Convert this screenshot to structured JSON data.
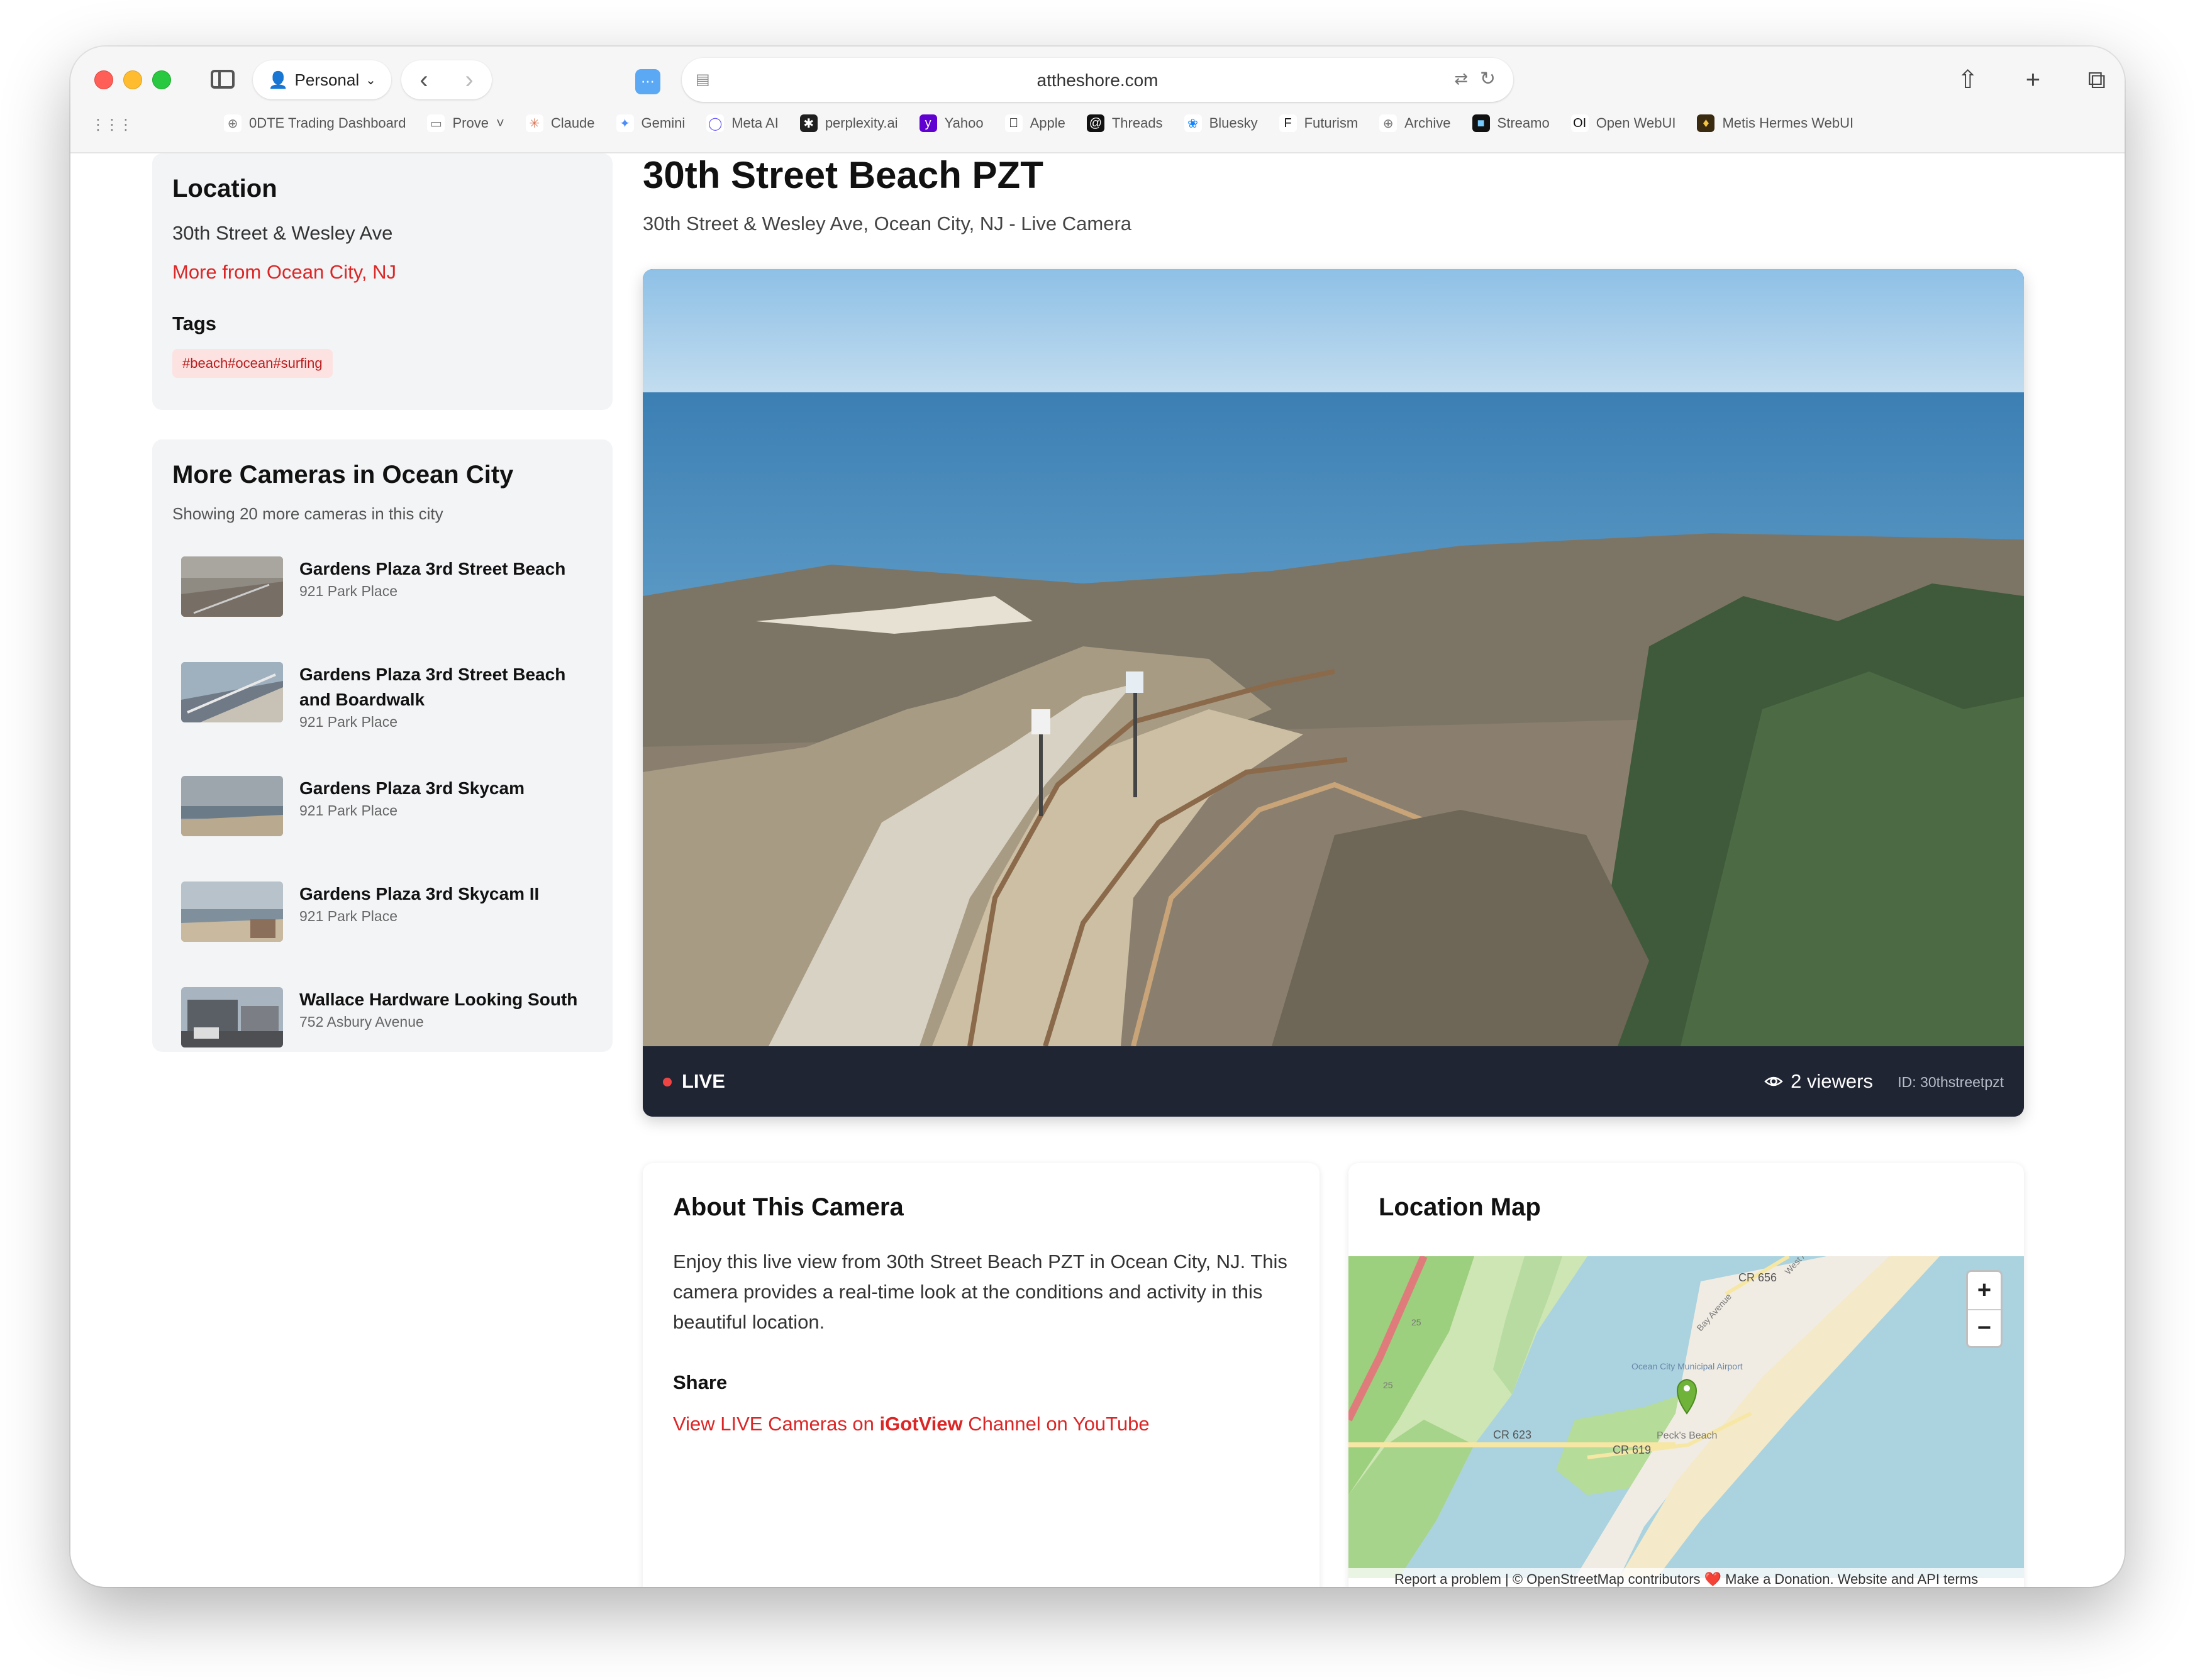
{
  "browser": {
    "profile_label": "Personal",
    "url": "attheshore.com",
    "bookmarks": [
      {
        "label": "0DTE Trading Dashboard",
        "icon": "globe-icon"
      },
      {
        "label": "Prove",
        "icon": "folder-icon"
      },
      {
        "label": "Claude",
        "icon": "claude-icon"
      },
      {
        "label": "Gemini",
        "icon": "gemini-icon"
      },
      {
        "label": "Meta AI",
        "icon": "meta-ai-icon"
      },
      {
        "label": "perplexity.ai",
        "icon": "perplexity-icon"
      },
      {
        "label": "Yahoo",
        "icon": "yahoo-icon"
      },
      {
        "label": "Apple",
        "icon": "apple-icon"
      },
      {
        "label": "Threads",
        "icon": "threads-icon"
      },
      {
        "label": "Bluesky",
        "icon": "bluesky-icon"
      },
      {
        "label": "Futurism",
        "icon": "futurism-icon"
      },
      {
        "label": "Archive",
        "icon": "globe-icon"
      },
      {
        "label": "Streamo",
        "icon": "streamo-icon"
      },
      {
        "label": "Open WebUI",
        "icon": "openwebui-icon"
      },
      {
        "label": "Metis Hermes WebUI",
        "icon": "metis-icon"
      }
    ]
  },
  "sidebar": {
    "location": {
      "heading": "Location",
      "address": "30th Street & Wesley Ave",
      "more_link": "More from Ocean City, NJ",
      "tags_heading": "Tags",
      "tags": "#beach#ocean#surfing"
    },
    "more_cameras": {
      "heading": "More Cameras in Ocean City",
      "subtitle": "Showing 20 more cameras in this city",
      "items": [
        {
          "title": "Gardens Plaza 3rd Street Beach",
          "address": "921 Park Place"
        },
        {
          "title": "Gardens Plaza 3rd Street Beach and Boardwalk",
          "address": "921 Park Place"
        },
        {
          "title": "Gardens Plaza 3rd Skycam",
          "address": "921 Park Place"
        },
        {
          "title": "Gardens Plaza 3rd Skycam II",
          "address": "921 Park Place"
        },
        {
          "title": "Wallace Hardware Looking South",
          "address": "752 Asbury Avenue"
        }
      ]
    }
  },
  "main": {
    "title": "30th Street Beach PZT",
    "subtitle": "30th Street & Wesley Ave, Ocean City, NJ - Live Camera",
    "player": {
      "live_label": "LIVE",
      "viewers": "2 viewers",
      "camera_id": "ID: 30thstreetpzt"
    },
    "about": {
      "heading": "About This Camera",
      "description": "Enjoy this live view from 30th Street Beach PZT in Ocean City, NJ. This camera provides a real-time look at the conditions and activity in this beautiful location.",
      "share_heading": "Share",
      "share_prefix": "View LIVE Cameras on ",
      "share_brand": "iGotView",
      "share_suffix": " Channel on YouTube"
    },
    "map": {
      "heading": "Location Map",
      "zoom_in": "+",
      "zoom_out": "−",
      "attribution": "Report a problem | © OpenStreetMap contributors ❤️ Make a Donation. Website and API terms",
      "labels": [
        "CR 656",
        "Bay Avenue",
        "West Ave",
        "Ocean City Municipal Airport",
        "CR 623",
        "CR 619",
        "Peck's Beach",
        "25",
        "25"
      ]
    }
  },
  "colors": {
    "accent_red": "#dc2626",
    "player_bar": "#1f2533",
    "live_dot": "#ef4444",
    "card_bg": "#f3f4f6"
  }
}
